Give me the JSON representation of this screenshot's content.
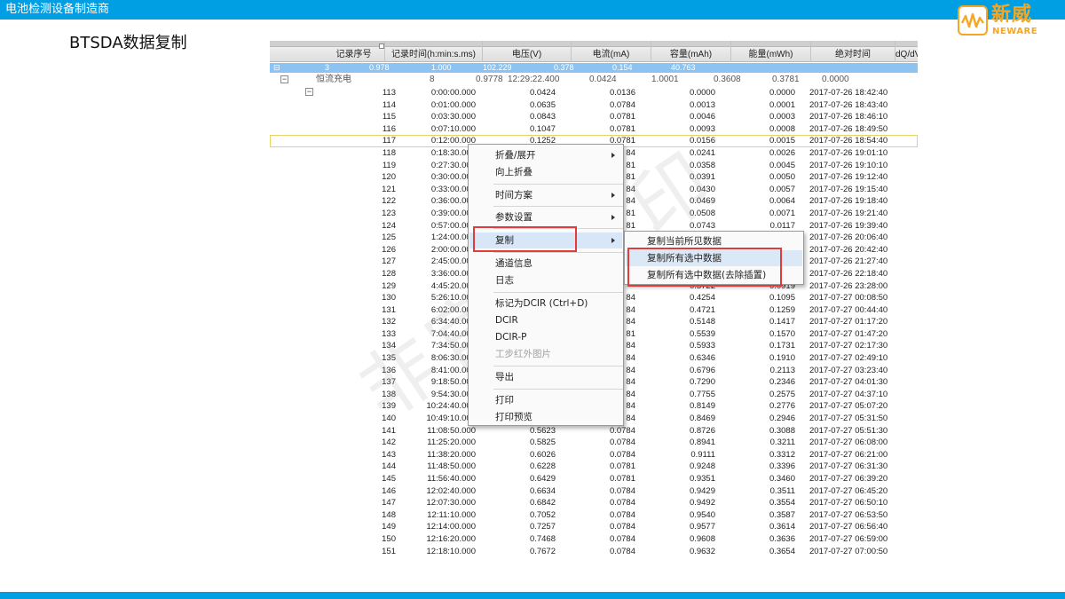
{
  "header": {
    "title": "电池检测设备制造商"
  },
  "logo": {
    "cn": "新威",
    "en": "NEWARE"
  },
  "slide": {
    "title": "BTSDA数据复制"
  },
  "table": {
    "columns": [
      "记录序号",
      "记录时间(h:min:s.ms)",
      "电压(V)",
      "电流(mA)",
      "容量(mAh)",
      "能量(mWh)",
      "绝对时间",
      "dQ/dV(m"
    ],
    "selected_row": [
      "3",
      "0.978",
      "1.000",
      "102.229",
      "0.378",
      "0.154",
      "40.763"
    ],
    "group_row": [
      "8",
      "0.9778",
      "12:29:22.400",
      "0.0424",
      "1.0001",
      "0.3608",
      "0.3781",
      "0.0000"
    ],
    "group_label": "恒流充电",
    "rows": [
      [
        "113",
        "0:00:00.000",
        "0.0424",
        "0.0136",
        "0.0000",
        "0.0000",
        "2017-07-26 18:42:40"
      ],
      [
        "114",
        "0:01:00.000",
        "0.0635",
        "0.0784",
        "0.0013",
        "0.0001",
        "2017-07-26 18:43:40"
      ],
      [
        "115",
        "0:03:30.000",
        "0.0843",
        "0.0781",
        "0.0046",
        "0.0003",
        "2017-07-26 18:46:10"
      ],
      [
        "116",
        "0:07:10.000",
        "0.1047",
        "0.0781",
        "0.0093",
        "0.0008",
        "2017-07-26 18:49:50"
      ],
      [
        "117",
        "0:12:00.000",
        "0.1252",
        "0.0781",
        "0.0156",
        "0.0015",
        "2017-07-26 18:54:40"
      ],
      [
        "118",
        "0:18:30.000",
        "",
        "84",
        "0.0241",
        "0.0026",
        "2017-07-26 19:01:10"
      ],
      [
        "119",
        "0:27:30.000",
        "",
        "81",
        "0.0358",
        "0.0045",
        "2017-07-26 19:10:10"
      ],
      [
        "120",
        "0:30:00.000",
        "",
        "81",
        "0.0391",
        "0.0050",
        "2017-07-26 19:12:40"
      ],
      [
        "121",
        "0:33:00.000",
        "",
        "84",
        "0.0430",
        "0.0057",
        "2017-07-26 19:15:40"
      ],
      [
        "122",
        "0:36:00.000",
        "",
        "84",
        "0.0469",
        "0.0064",
        "2017-07-26 19:18:40"
      ],
      [
        "123",
        "0:39:00.000",
        "",
        "81",
        "0.0508",
        "0.0071",
        "2017-07-26 19:21:40"
      ],
      [
        "124",
        "0:57:00.000",
        "",
        "81",
        "0.0743",
        "0.0117",
        "2017-07-26 19:39:40"
      ],
      [
        "125",
        "1:24:00.000",
        "",
        "",
        "",
        "",
        "2017-07-26 20:06:40"
      ],
      [
        "126",
        "2:00:00.000",
        "",
        "",
        "",
        "",
        "2017-07-26 20:42:40"
      ],
      [
        "127",
        "2:45:00.000",
        "",
        "",
        "",
        "",
        "2017-07-26 21:27:40"
      ],
      [
        "128",
        "3:36:00.000",
        "",
        "",
        "",
        "",
        "2017-07-26 22:18:40"
      ],
      [
        "129",
        "4:45:20.000",
        "",
        "",
        "0.3722",
        "0.0919",
        "2017-07-26 23:28:00"
      ],
      [
        "130",
        "5:26:10.000",
        "",
        "84",
        "0.4254",
        "0.1095",
        "2017-07-27 00:08:50"
      ],
      [
        "131",
        "6:02:00.000",
        "",
        "84",
        "0.4721",
        "0.1259",
        "2017-07-27 00:44:40"
      ],
      [
        "132",
        "6:34:40.000",
        "",
        "84",
        "0.5148",
        "0.1417",
        "2017-07-27 01:17:20"
      ],
      [
        "133",
        "7:04:40.000",
        "",
        "81",
        "0.5539",
        "0.1570",
        "2017-07-27 01:47:20"
      ],
      [
        "134",
        "7:34:50.000",
        "",
        "84",
        "0.5933",
        "0.1731",
        "2017-07-27 02:17:30"
      ],
      [
        "135",
        "8:06:30.000",
        "",
        "84",
        "0.6346",
        "0.1910",
        "2017-07-27 02:49:10"
      ],
      [
        "136",
        "8:41:00.000",
        "",
        "84",
        "0.6796",
        "0.2113",
        "2017-07-27 03:23:40"
      ],
      [
        "137",
        "9:18:50.000",
        "",
        "84",
        "0.7290",
        "0.2346",
        "2017-07-27 04:01:30"
      ],
      [
        "138",
        "9:54:30.000",
        "",
        "84",
        "0.7755",
        "0.2575",
        "2017-07-27 04:37:10"
      ],
      [
        "139",
        "10:24:40.000",
        "",
        "84",
        "0.8149",
        "0.2776",
        "2017-07-27 05:07:20"
      ],
      [
        "140",
        "10:49:10.000",
        "",
        "84",
        "0.8469",
        "0.2946",
        "2017-07-27 05:31:50"
      ],
      [
        "141",
        "11:08:50.000",
        "0.5623",
        "0.0784",
        "0.8726",
        "0.3088",
        "2017-07-27 05:51:30"
      ],
      [
        "142",
        "11:25:20.000",
        "0.5825",
        "0.0784",
        "0.8941",
        "0.3211",
        "2017-07-27 06:08:00"
      ],
      [
        "143",
        "11:38:20.000",
        "0.6026",
        "0.0784",
        "0.9111",
        "0.3312",
        "2017-07-27 06:21:00"
      ],
      [
        "144",
        "11:48:50.000",
        "0.6228",
        "0.0781",
        "0.9248",
        "0.3396",
        "2017-07-27 06:31:30"
      ],
      [
        "145",
        "11:56:40.000",
        "0.6429",
        "0.0781",
        "0.9351",
        "0.3460",
        "2017-07-27 06:39:20"
      ],
      [
        "146",
        "12:02:40.000",
        "0.6634",
        "0.0784",
        "0.9429",
        "0.3511",
        "2017-07-27 06:45:20"
      ],
      [
        "147",
        "12:07:30.000",
        "0.6842",
        "0.0784",
        "0.9492",
        "0.3554",
        "2017-07-27 06:50:10"
      ],
      [
        "148",
        "12:11:10.000",
        "0.7052",
        "0.0784",
        "0.9540",
        "0.3587",
        "2017-07-27 06:53:50"
      ],
      [
        "149",
        "12:14:00.000",
        "0.7257",
        "0.0784",
        "0.9577",
        "0.3614",
        "2017-07-27 06:56:40"
      ],
      [
        "150",
        "12:16:20.000",
        "0.7468",
        "0.0784",
        "0.9608",
        "0.3636",
        "2017-07-27 06:59:00"
      ],
      [
        "151",
        "12:18:10.000",
        "0.7672",
        "0.0784",
        "0.9632",
        "0.3654",
        "2017-07-27 07:00:50"
      ]
    ]
  },
  "context_menu": {
    "items": [
      "折叠/展开",
      "向上折叠",
      "时间方案",
      "参数设置",
      "复制",
      "通道信息",
      "日志",
      "标记为DCIR (Ctrl+D)",
      "DCIR",
      "DCIR-P",
      "工步红外图片",
      "导出",
      "打印",
      "打印预览"
    ]
  },
  "submenu": {
    "items": [
      "复制当前所见数据",
      "复制所有选中数据",
      "复制所有选中数据(去除插置)"
    ]
  },
  "watermark": {
    "text": "非官方水印"
  },
  "colors": {
    "accent": "#009fe3",
    "brand": "#f5a623",
    "highlight": "#e23b3b"
  }
}
